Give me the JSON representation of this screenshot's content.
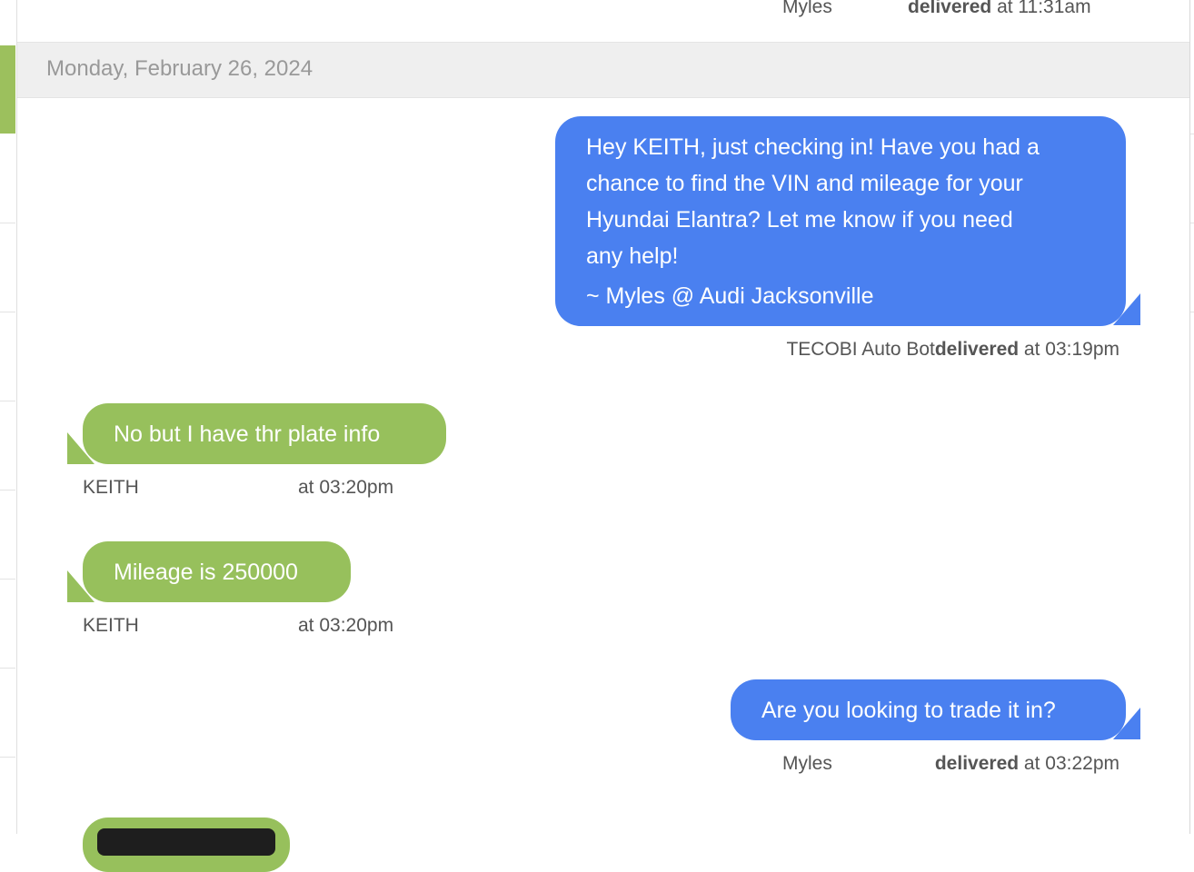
{
  "top_meta": {
    "sender": "Myles",
    "status": "delivered",
    "time_text": "at 11:31am"
  },
  "date_header": "Monday, February 26, 2024",
  "messages": [
    {
      "direction": "outgoing",
      "lines": [
        "Hey KEITH, just checking in! Have you had a",
        "chance to find the VIN and mileage for your",
        "Hyundai Elantra? Let me know if you need",
        "any help!"
      ],
      "signature": "~ Myles @ Audi Jacksonville",
      "sender": "TECOBI Auto Bot",
      "status": "delivered",
      "time_text": "at 03:19pm"
    },
    {
      "direction": "incoming",
      "text": "No but I have thr plate info",
      "sender": "KEITH",
      "time_text": "at 03:20pm"
    },
    {
      "direction": "incoming",
      "text": "Mileage is 250000",
      "sender": "KEITH",
      "time_text": "at 03:20pm"
    },
    {
      "direction": "outgoing",
      "text": "Are you looking to trade it in?",
      "sender": "Myles",
      "status": "delivered",
      "time_text": "at 03:22pm"
    }
  ],
  "colors": {
    "outgoing_bubble": "#4a80f0",
    "incoming_bubble": "#97c05c",
    "date_bar": "#efefef"
  }
}
